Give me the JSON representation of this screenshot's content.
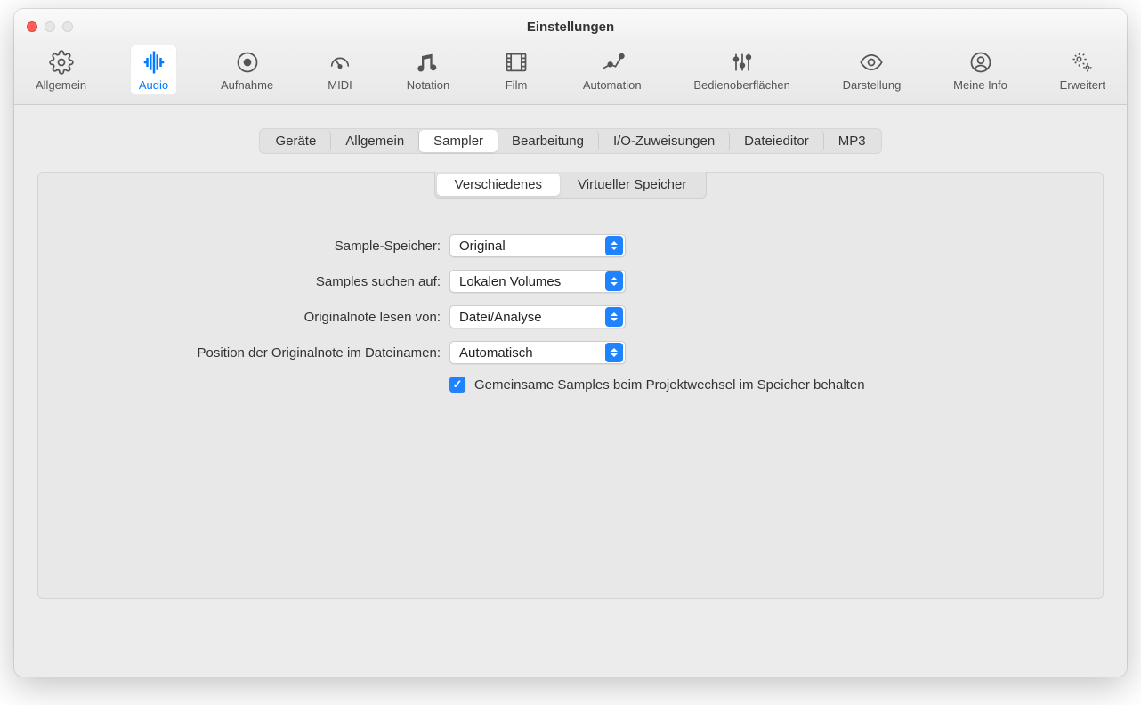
{
  "window": {
    "title": "Einstellungen"
  },
  "toolbar": {
    "items": [
      {
        "label": "Allgemein"
      },
      {
        "label": "Audio"
      },
      {
        "label": "Aufnahme"
      },
      {
        "label": "MIDI"
      },
      {
        "label": "Notation"
      },
      {
        "label": "Film"
      },
      {
        "label": "Automation"
      },
      {
        "label": "Bedienoberflächen"
      },
      {
        "label": "Darstellung"
      },
      {
        "label": "Meine Info"
      },
      {
        "label": "Erweitert"
      }
    ],
    "selected_index": 1
  },
  "tabs": {
    "items": [
      "Geräte",
      "Allgemein",
      "Sampler",
      "Bearbeitung",
      "I/O-Zuweisungen",
      "Dateieditor",
      "MP3"
    ],
    "selected": "Sampler"
  },
  "subtabs": {
    "items": [
      "Verschiedenes",
      "Virtueller Speicher"
    ],
    "selected": "Verschiedenes"
  },
  "form": {
    "row0": {
      "label": "Sample-Speicher:",
      "value": "Original"
    },
    "row1": {
      "label": "Samples suchen auf:",
      "value": "Lokalen Volumes"
    },
    "row2": {
      "label": "Originalnote lesen von:",
      "value": "Datei/Analyse"
    },
    "row3": {
      "label": "Position der Originalnote im Dateinamen:",
      "value": "Automatisch"
    },
    "checkbox": {
      "checked": true,
      "label": "Gemeinsame Samples beim Projektwechsel im Speicher behalten"
    }
  }
}
